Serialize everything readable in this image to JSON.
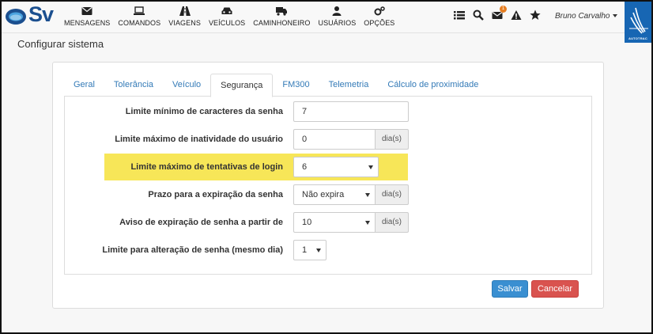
{
  "brand": {
    "logo_text": "Sv"
  },
  "nav": {
    "items": [
      {
        "label": "MENSAGENS",
        "icon": "envelope-icon"
      },
      {
        "label": "COMANDOS",
        "icon": "laptop-icon"
      },
      {
        "label": "VIAGENS",
        "icon": "road-icon"
      },
      {
        "label": "VEÍCULOS",
        "icon": "car-icon"
      },
      {
        "label": "CAMINHONEIRO",
        "icon": "truck-icon"
      },
      {
        "label": "USUÁRIOS",
        "icon": "user-icon"
      },
      {
        "label": "OPÇÕES",
        "icon": "gears-icon"
      }
    ],
    "notification_count": "1",
    "user_name": "Bruno Carvalho",
    "partner_logo_text": "AUTOTRAC"
  },
  "page": {
    "title": "Configurar sistema"
  },
  "tabs": [
    {
      "label": "Geral",
      "active": false
    },
    {
      "label": "Tolerância",
      "active": false
    },
    {
      "label": "Veículo",
      "active": false
    },
    {
      "label": "Segurança",
      "active": true
    },
    {
      "label": "FM300",
      "active": false
    },
    {
      "label": "Telemetria",
      "active": false
    },
    {
      "label": "Cálculo de proximidade",
      "active": false
    }
  ],
  "security": {
    "min_chars": {
      "label": "Limite mínimo de caracteres da senha",
      "value": "7"
    },
    "max_inactivity": {
      "label": "Limite máximo de inatividade do usuário",
      "value": "0",
      "unit": "dia(s)"
    },
    "max_attempts": {
      "label": "Limite máximo de tentativas de login",
      "value": "6"
    },
    "expiration": {
      "label": "Prazo para a expiração da senha",
      "value": "Não expira",
      "unit": "dia(s)"
    },
    "expiration_warning": {
      "label": "Aviso de expiração de senha a partir de",
      "value": "10",
      "unit": "dia(s)"
    },
    "change_limit": {
      "label": "Limite para alteração de senha (mesmo dia)",
      "value": "1"
    }
  },
  "actions": {
    "save": "Salvar",
    "cancel": "Cancelar"
  },
  "colors": {
    "primary": "#3a8fd1",
    "danger": "#d9534f",
    "highlight": "#f7e658",
    "brand": "#1766b3"
  }
}
